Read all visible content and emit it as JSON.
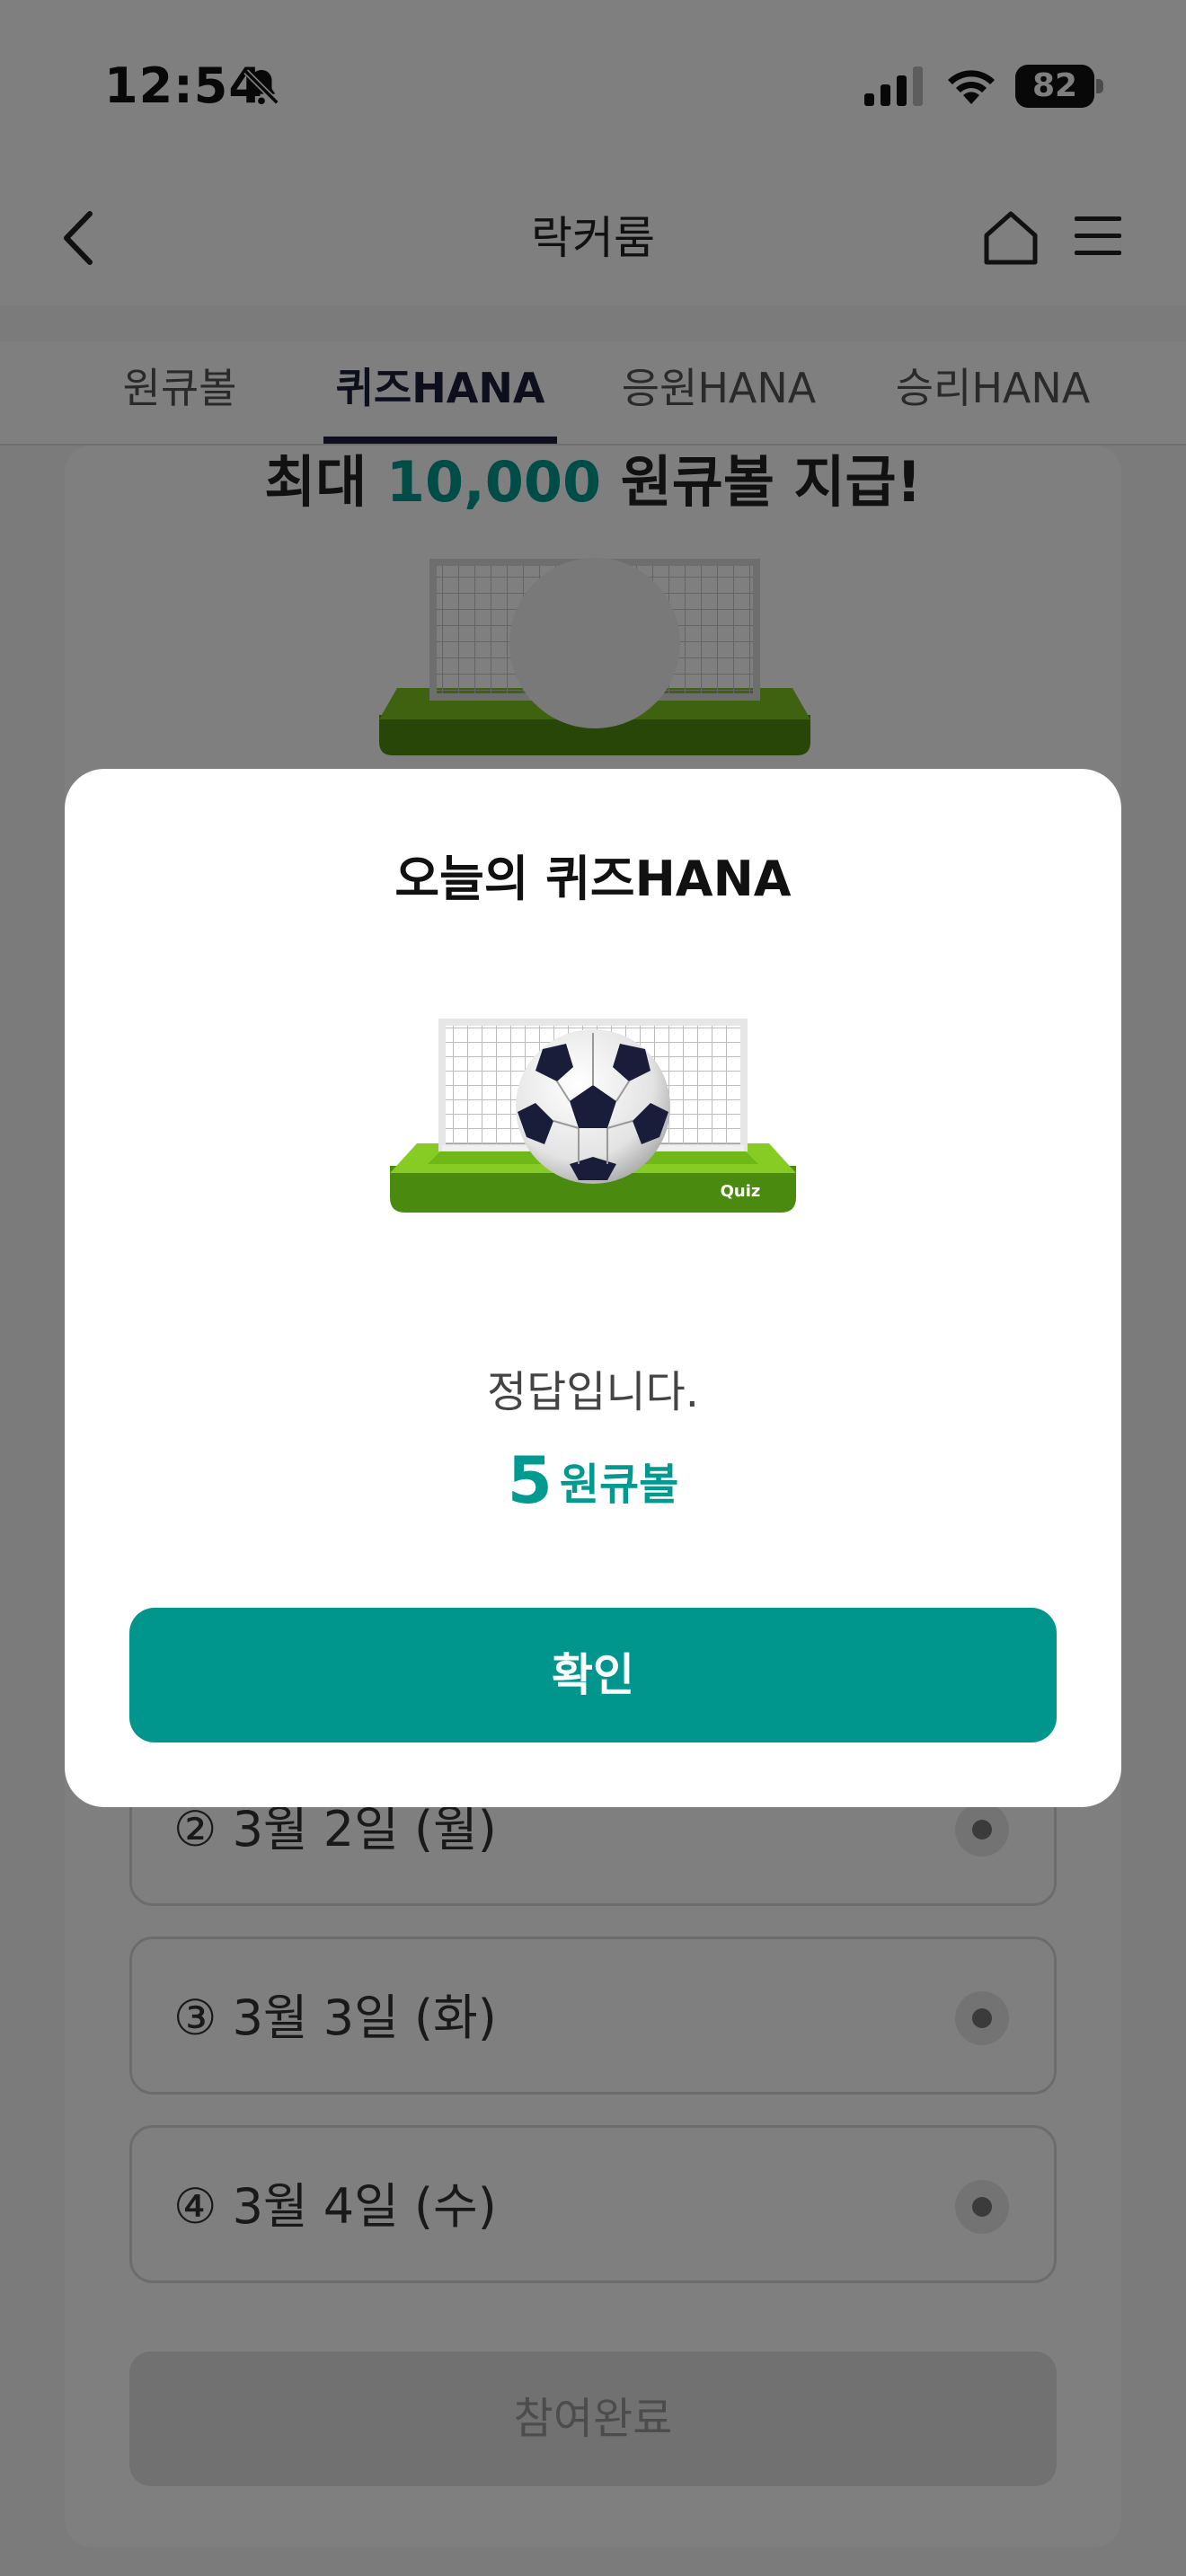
{
  "status_bar": {
    "time": "12:54",
    "battery": "82"
  },
  "nav": {
    "title": "락커룸"
  },
  "tabs": [
    {
      "label": "원큐볼"
    },
    {
      "label": "퀴즈HANA"
    },
    {
      "label": "응원HANA"
    },
    {
      "label": "승리HANA"
    }
  ],
  "background": {
    "promo_prefix": "최대",
    "promo_accent": "10,000",
    "promo_suffix": "원큐볼 지급!",
    "options": [
      {
        "label": "② 3월 2일 (월)"
      },
      {
        "label": "③ 3월 3일 (화)"
      },
      {
        "label": "④ 3월 4일 (수)"
      }
    ],
    "submit_label": "참여완료"
  },
  "modal": {
    "title": "오늘의 퀴즈HANA",
    "badge_text": "Quiz",
    "message": "정답입니다.",
    "reward_amount": "5",
    "reward_unit": "원큐볼",
    "confirm_label": "확인"
  },
  "colors": {
    "accent": "#00968d",
    "tab_active": "#1c1f3b"
  },
  "icons": [
    "bell-slash-icon",
    "signal-icon",
    "wifi-icon",
    "battery-icon",
    "back-icon",
    "home-icon",
    "menu-icon",
    "soccer-goal-icon"
  ]
}
